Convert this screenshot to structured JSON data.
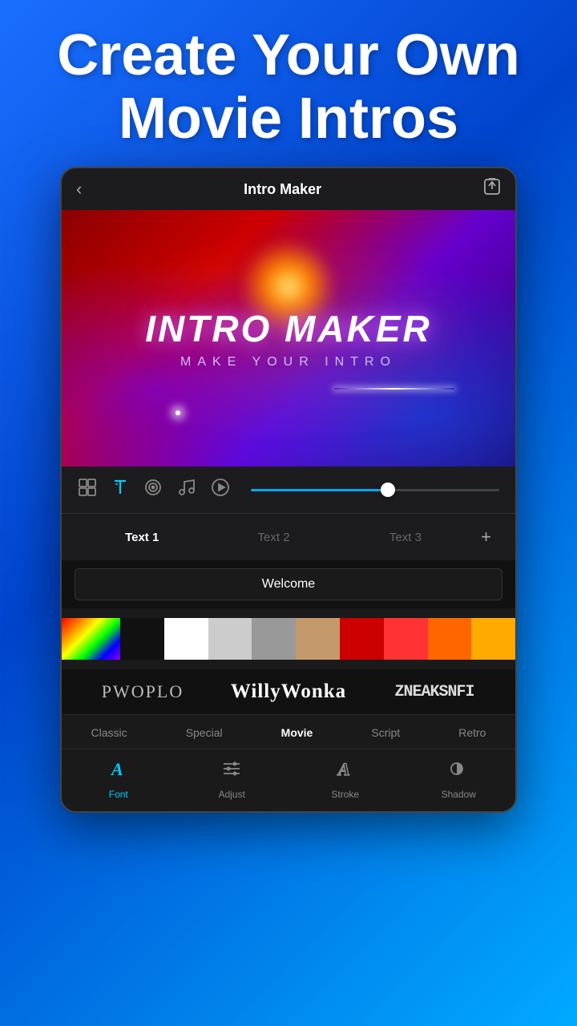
{
  "hero": {
    "line1": "Create Your Own",
    "line2": "Movie Intros"
  },
  "appBar": {
    "back_label": "‹",
    "title": "Intro Maker",
    "share_label": "⬜"
  },
  "videoPreview": {
    "mainTitle": "INTRO MAKER",
    "subTitle": "MAKE YOUR INTRO"
  },
  "toolbar": {
    "icons": [
      "layers",
      "text",
      "target",
      "music",
      "play"
    ]
  },
  "textTabs": {
    "tabs": [
      "Text 1",
      "Text 2",
      "Text 3"
    ],
    "add_label": "+"
  },
  "textInput": {
    "value": "Welcome"
  },
  "colorPalette": {
    "colors": [
      "#e040fb,#ffeb3b,#69f0ae,#2979ff",
      "#000000",
      "#ffffff",
      "#cccccc",
      "#999999",
      "#c49a6c",
      "#cc0000",
      "#ff4444",
      "#ff6600",
      "#ffaa00"
    ]
  },
  "fontPreview": {
    "samples": [
      {
        "text": "PWOPLO",
        "style": "normal"
      },
      {
        "text": "WillyWonka",
        "style": "wonka"
      },
      {
        "text": "ZNEAKSNFI",
        "style": "grunge"
      }
    ]
  },
  "fontCategories": {
    "items": [
      "Classic",
      "Special",
      "Movie",
      "Script",
      "Retro"
    ],
    "active": "Movie"
  },
  "bottomNav": {
    "items": [
      {
        "id": "font",
        "label": "Font",
        "active": true
      },
      {
        "id": "adjust",
        "label": "Adjust",
        "active": false
      },
      {
        "id": "stroke",
        "label": "Stroke",
        "active": false
      },
      {
        "id": "shadow",
        "label": "Shadow",
        "active": false
      }
    ]
  }
}
